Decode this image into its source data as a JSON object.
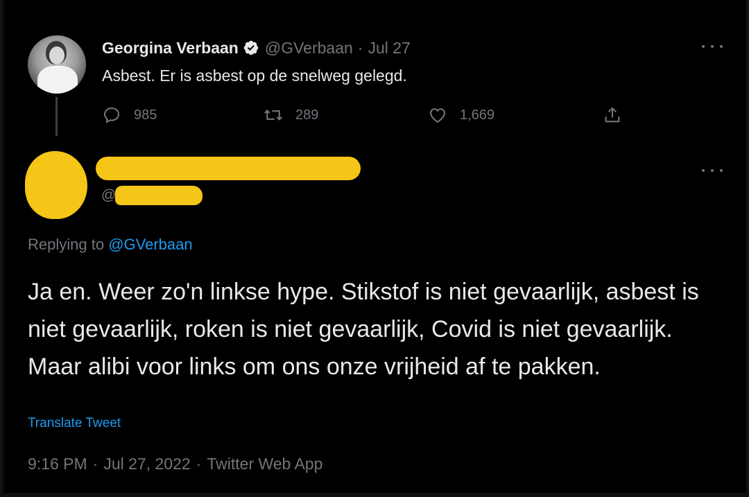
{
  "parent_tweet": {
    "display_name": "Georgina Verbaan",
    "handle": "@GVerbaan",
    "separator": "·",
    "date": "Jul 27",
    "text": "Asbest. Er is asbest op de snelweg gelegd.",
    "counts": {
      "replies": "985",
      "retweets": "289",
      "likes": "1,669"
    },
    "verified": true
  },
  "reply_tweet": {
    "handle_prefix": "@",
    "replying_prefix": "Replying to ",
    "replying_to": "@GVerbaan",
    "text": "Ja en. Weer zo'n linkse hype. Stikstof is niet gevaarlijk, asbest is niet gevaarlijk, roken is niet gevaarlijk, Covid is niet gevaarlijk. Maar alibi voor links om ons onze vrijheid af te pakken.",
    "translate_label": "Translate Tweet",
    "time": "9:16 PM",
    "date": "Jul 27, 2022",
    "source": "Twitter Web App",
    "meta_separator": "·"
  },
  "colors": {
    "background": "#000000",
    "text_primary": "#e7e9ea",
    "text_secondary": "#71767b",
    "link": "#1d9bf0",
    "redaction": "#f5c518"
  },
  "icons": [
    "verified-badge-icon",
    "reply-icon",
    "retweet-icon",
    "like-icon",
    "share-icon",
    "more-icon"
  ]
}
